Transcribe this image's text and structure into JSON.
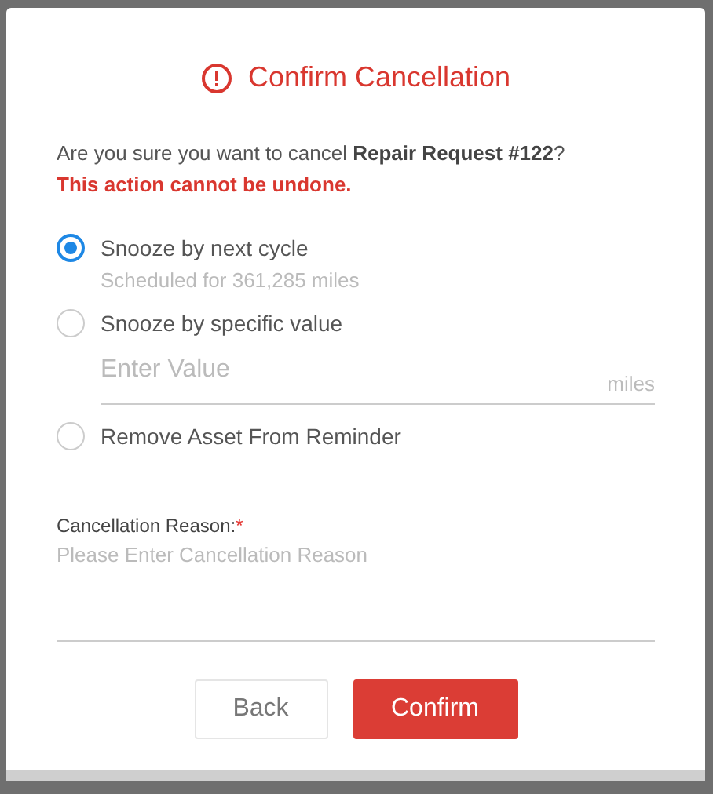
{
  "dialog": {
    "title": "Confirm Cancellation",
    "message": "Are you sure you want to cancel **Repair Request #122**?",
    "warning": "This action cannot be undone.",
    "options": [
      {
        "label": "Snooze by next cycle",
        "selected": true,
        "hint": "Scheduled for 361,285 miles"
      },
      {
        "label": "Snooze by specific value",
        "selected": false,
        "field": {
          "placeholder": "Enter Value",
          "unit": "miles"
        }
      },
      {
        "label": "Remove Asset From Reminder",
        "selected": false
      }
    ],
    "reason": {
      "label": "Cancellation Reason:",
      "required_mark": "*",
      "placeholder": "Please Enter Cancellation Reason"
    },
    "buttons": [
      {
        "label": "Back",
        "kind": "secondary"
      },
      {
        "label": "Confirm",
        "kind": "primary"
      }
    ]
  }
}
